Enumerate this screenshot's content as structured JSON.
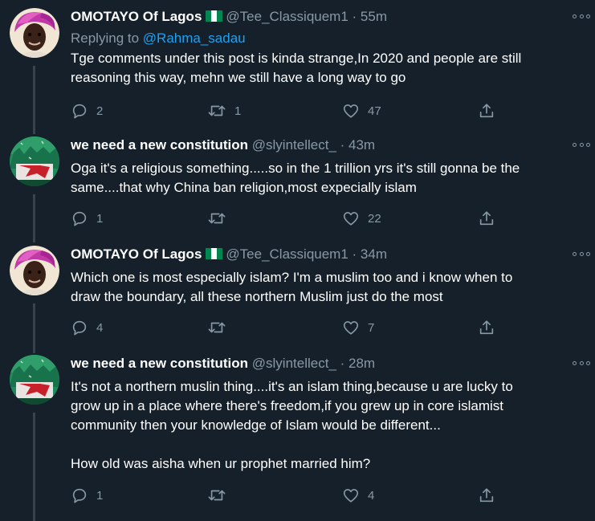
{
  "tweets": [
    {
      "name": "OMOTAYO Of Lagos",
      "has_flag": true,
      "handle": "@Tee_Classiquem1",
      "time": "· 55m",
      "replying_prefix": "Replying to",
      "replying_handle": "@Rahma_sadau",
      "text": "Tge comments under this post is kinda strange,In 2020 and people are still\nreasoning this way, mehn we still have a long way to go",
      "reply_count": "2",
      "retweet_count": "1",
      "like_count": "47",
      "avatar": "pink-gele-woman"
    },
    {
      "name": "we need a new constitution",
      "has_flag": false,
      "handle": "@slyintellect_",
      "time": "· 43m",
      "text": "Oga it's a religious something.....so in the 1 trillion yrs it's still gonna be the\nsame....that why China ban religion,most expecially islam",
      "reply_count": "1",
      "retweet_count": "",
      "like_count": "22",
      "avatar": "green-red-wall"
    },
    {
      "name": "OMOTAYO Of Lagos",
      "has_flag": true,
      "handle": "@Tee_Classiquem1",
      "time": "· 34m",
      "text": "Which one is most especially islam? I'm a muslim too and i know when to\ndraw the boundary, all these northern Muslim just do the most",
      "reply_count": "4",
      "retweet_count": "",
      "like_count": "7",
      "avatar": "pink-gele-woman"
    },
    {
      "name": "we need a new constitution",
      "has_flag": false,
      "handle": "@slyintellect_",
      "time": "· 28m",
      "text": "It's not a northern muslin thing....it's an islam thing,because u are lucky to\ngrow up in a place where there's freedom,if you grew up in core islamist\ncommunity then your knowledge of Islam would be different...\n\nHow old was aisha when ur prophet married him?",
      "reply_count": "1",
      "retweet_count": "",
      "like_count": "4",
      "avatar": "green-red-wall"
    }
  ],
  "icons": {
    "reply": "reply-icon",
    "retweet": "retweet-icon",
    "like": "heart-icon",
    "share": "share-icon",
    "more": "more-options-icon"
  },
  "colors": {
    "background": "#15202b",
    "secondary_text": "#8899a6",
    "link": "#1da1f2",
    "thread_line": "#38444d",
    "flag_green": "#008751",
    "flag_white": "#ffffff"
  }
}
